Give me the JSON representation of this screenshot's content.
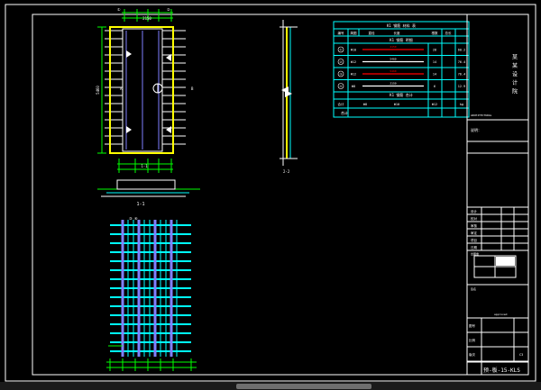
{
  "drawing": {
    "schedule_title": "K1 钢筋 材料 表",
    "schedule_headers": [
      "编号",
      "简图",
      "直径",
      "长度",
      "根数",
      "总长"
    ],
    "schedule_group_1": "K1 钢筋 明细",
    "schedule_group_2": "K1 钢筋 合计",
    "schedule_rows": [
      {
        "id": "①",
        "dia": "Φ10",
        "len": "2150",
        "count": "28",
        "total": "60.2"
      },
      {
        "id": "②",
        "dia": "Φ12",
        "len": "5460",
        "count": "14",
        "total": "76.4"
      },
      {
        "id": "③",
        "dia": "Φ12",
        "len": "5460",
        "count": "14",
        "total": "76.4"
      },
      {
        "id": "④",
        "dia": "Φ8",
        "len": "2150",
        "count": "6",
        "total": "12.9"
      }
    ],
    "schedule_totals": [
      "合计",
      "Φ8",
      "Φ10",
      "Φ12",
      "kg"
    ],
    "schedule_sum": "合计",
    "section_label": "1-1",
    "plan_label": "1-1",
    "side_note": "说明：",
    "title_block_header": "图纸名称",
    "company_name": "某 某 设 计 院",
    "info_labels": [
      "设计",
      "校对",
      "审核",
      "审定",
      "项目",
      "日期"
    ],
    "stamp_label": "出图章",
    "sign_label": "签名",
    "field_labels": [
      "图号",
      "比例",
      "版次"
    ],
    "field_values": [
      "",
      "",
      "C3"
    ],
    "drawing_number": "预-板-15-KLS"
  },
  "colors": {
    "background": "#000000",
    "frame": "#ffffff",
    "outline": "#ffff00",
    "rebar": "#00ffff",
    "rebar_alt": "#8080ff",
    "dimension": "#00ff00",
    "highlight": "#ff0000",
    "table": "#00ffff"
  },
  "scrollbar": {
    "label": "horizontal-scrollbar"
  }
}
